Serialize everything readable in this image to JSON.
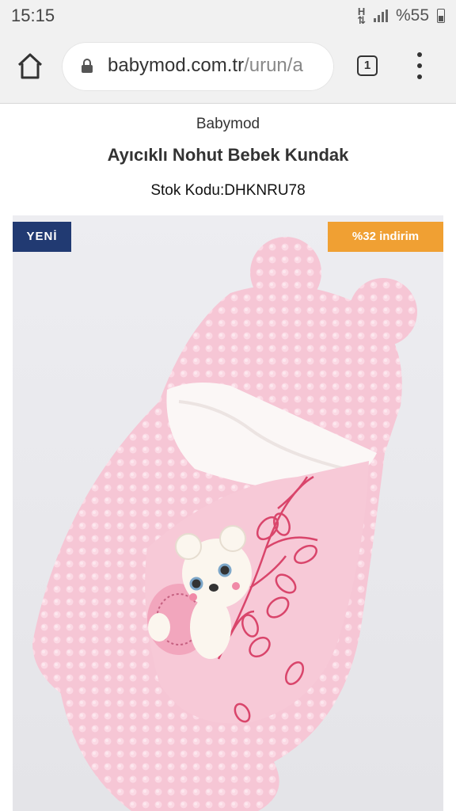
{
  "status_bar": {
    "time": "15:15",
    "battery": "%55",
    "icons": [
      "data-transfer-icon",
      "signal-icon",
      "battery-icon"
    ]
  },
  "browser": {
    "url_domain": "babymod.com.tr",
    "url_path": "/urun/a",
    "tab_count": "1",
    "icons": [
      "home-icon",
      "lock-icon",
      "tabs-icon",
      "more-menu-icon"
    ]
  },
  "product": {
    "brand": "Babymod",
    "title": "Ayıcıklı Nohut Bebek Kundak",
    "sku": "Stok Kodu:DHKNRU78",
    "badge_new": "YENİ",
    "badge_discount": "%32 indirim"
  },
  "colors": {
    "badge_new_bg": "#213a72",
    "badge_discount_bg": "#f0a033",
    "product_pink": "#f6c7d6"
  }
}
